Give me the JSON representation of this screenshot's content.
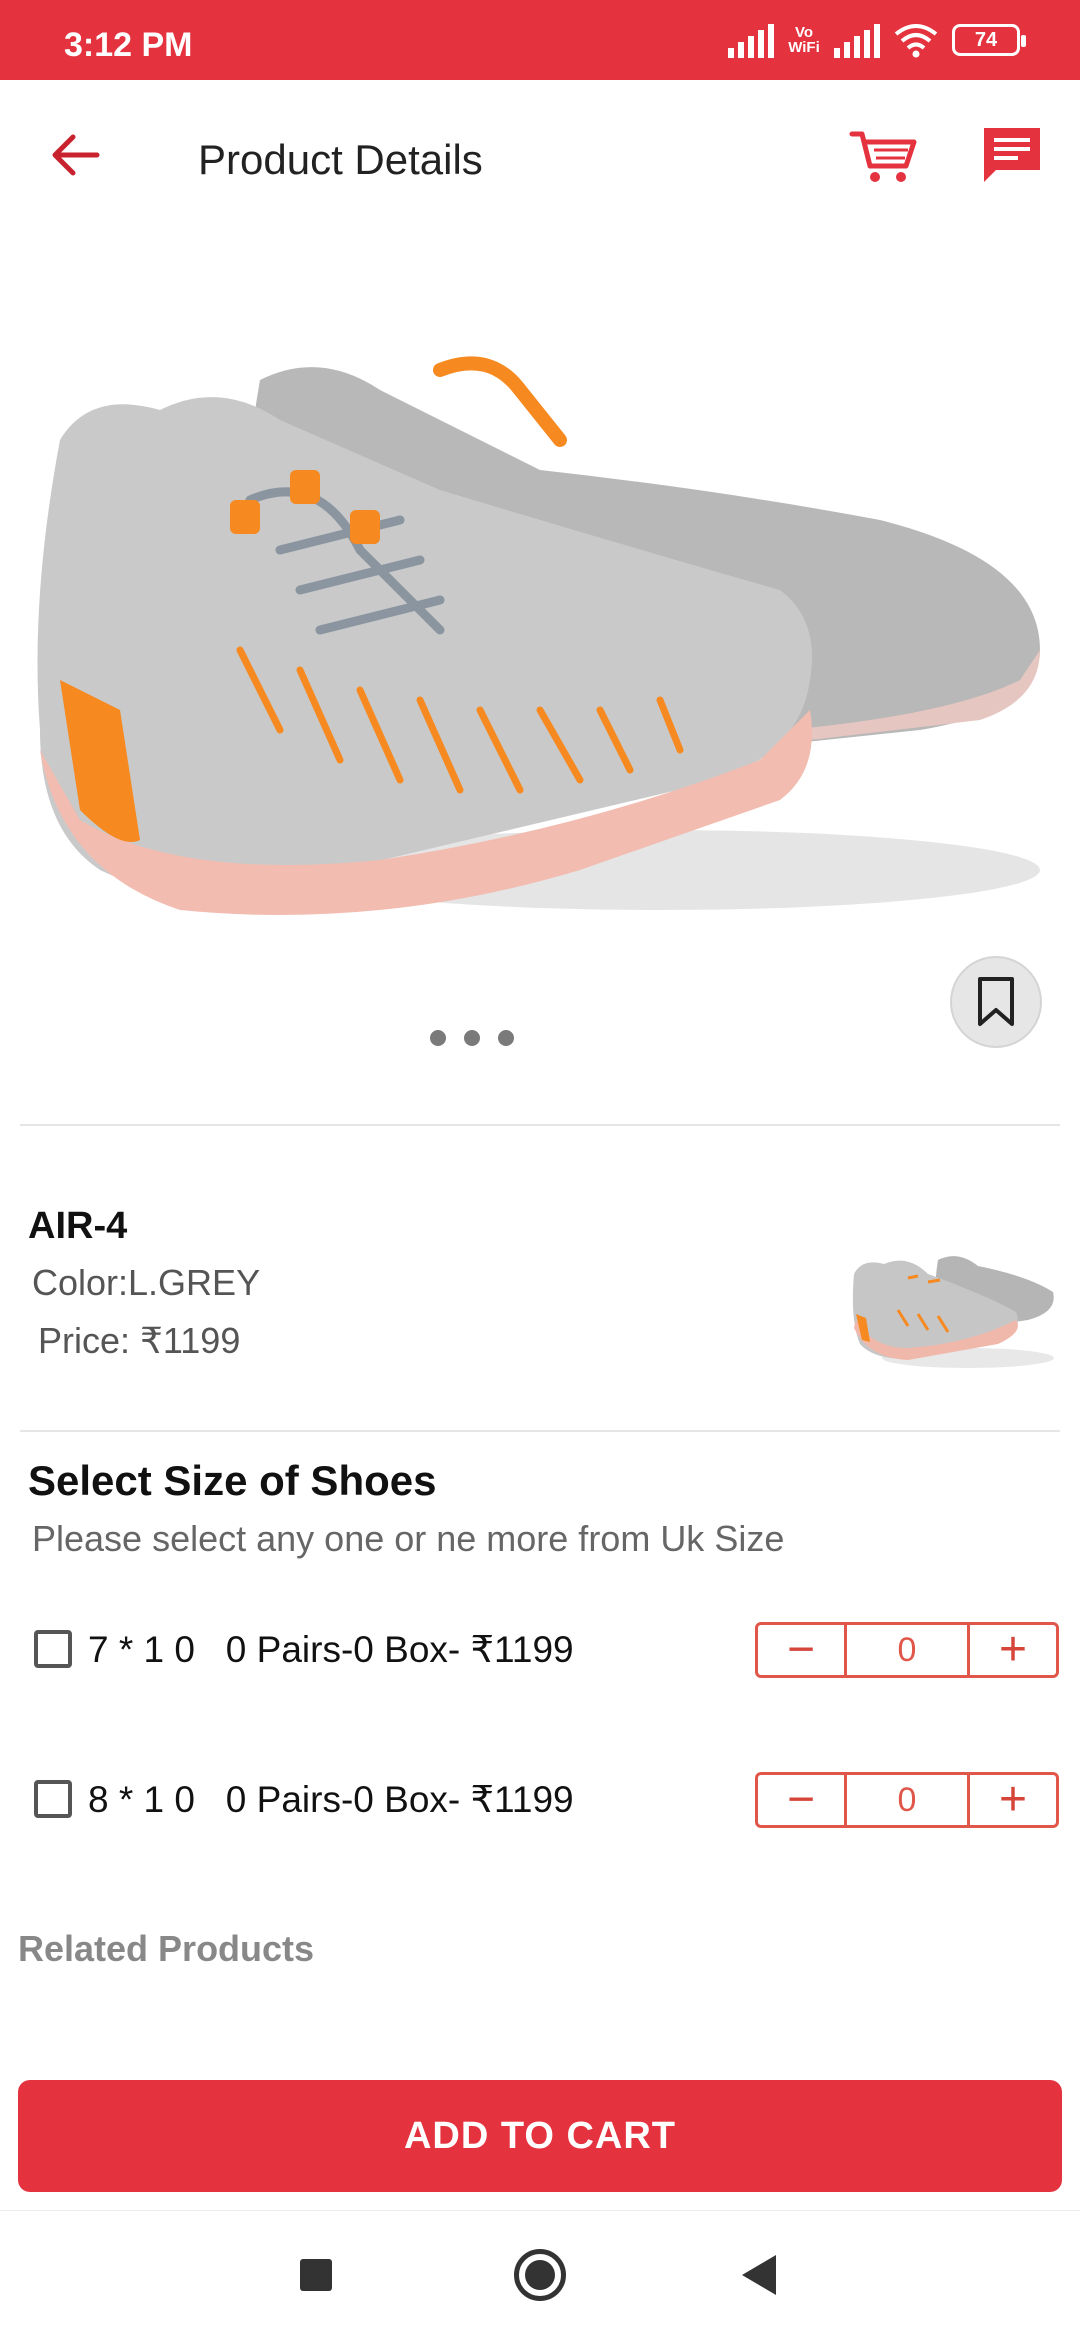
{
  "status_bar": {
    "time": "3:12 PM",
    "vowifi_label_top": "Vo",
    "vowifi_label_bottom": "WiFi",
    "battery": "74"
  },
  "header": {
    "title": "Product Details",
    "back_icon": "arrow-back-icon",
    "cart_icon": "cart-icon",
    "chat_icon": "chat-icon",
    "accent_color": "#e4323f"
  },
  "gallery": {
    "bookmark_icon": "bookmark-icon",
    "dot_count": 3
  },
  "product": {
    "name": "AIR-4",
    "color": "Color:L.GREY",
    "price": "Price: ₹1199"
  },
  "sizes": {
    "title": "Select Size of Shoes",
    "subtitle": "Please select any one or ne more from Uk Size",
    "rows": [
      {
        "label": "7 * 1 0   0 Pairs-0 Box- ₹1199",
        "quantity": "0",
        "minus": "−",
        "plus": "+"
      },
      {
        "label": "8 * 1 0   0 Pairs-0 Box- ₹1199",
        "quantity": "0",
        "minus": "−",
        "plus": "+"
      }
    ]
  },
  "related": {
    "title": "Related Products"
  },
  "actions": {
    "add_to_cart": "ADD TO CART"
  }
}
